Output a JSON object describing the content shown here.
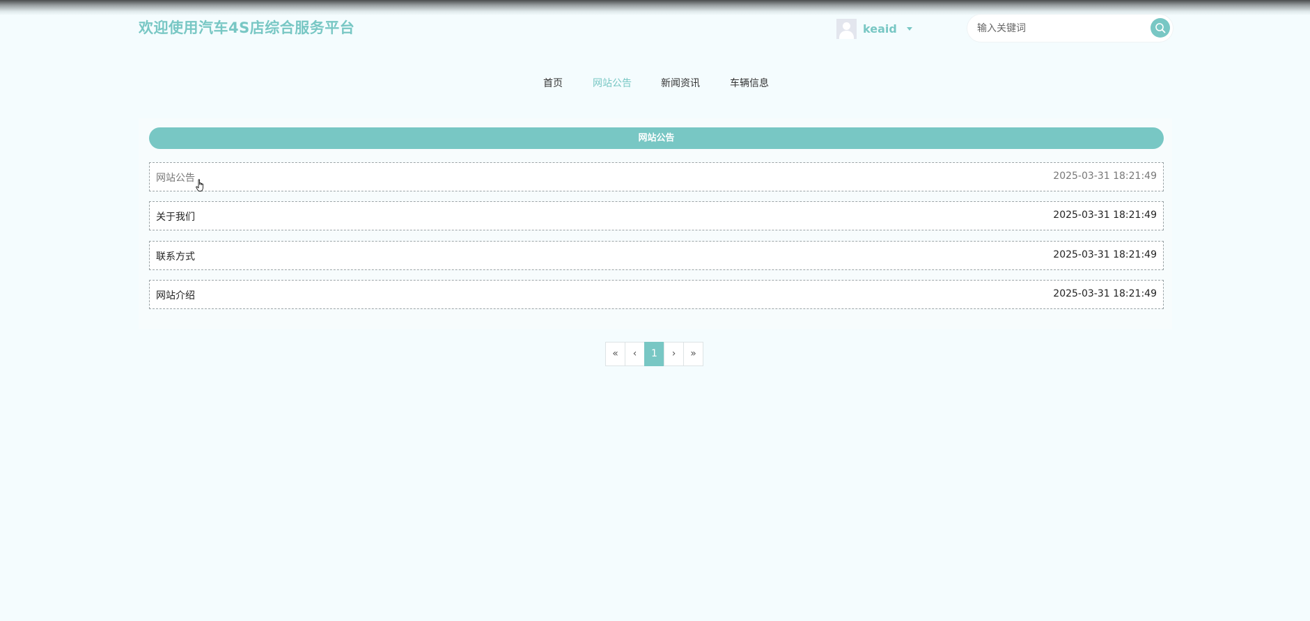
{
  "header": {
    "site_title": "欢迎使用汽车4S店综合服务平台",
    "username": "keaid",
    "search_placeholder": "输入关键词"
  },
  "nav": {
    "items": [
      {
        "label": "首页"
      },
      {
        "label": "网站公告",
        "active": true
      },
      {
        "label": "新闻资讯"
      },
      {
        "label": "车辆信息"
      }
    ]
  },
  "panel": {
    "title": "网站公告",
    "items": [
      {
        "title": "网站公告",
        "date": "2025-03-31 18:21:49"
      },
      {
        "title": "关于我们",
        "date": "2025-03-31 18:21:49"
      },
      {
        "title": "联系方式",
        "date": "2025-03-31 18:21:49"
      },
      {
        "title": "网站介绍",
        "date": "2025-03-31 18:21:49"
      }
    ]
  },
  "pagination": {
    "first": "«",
    "prev": "‹",
    "current": "1",
    "next": "›",
    "last": "»"
  },
  "colors": {
    "accent": "#78c7c4",
    "background": "#f4fcfe"
  }
}
